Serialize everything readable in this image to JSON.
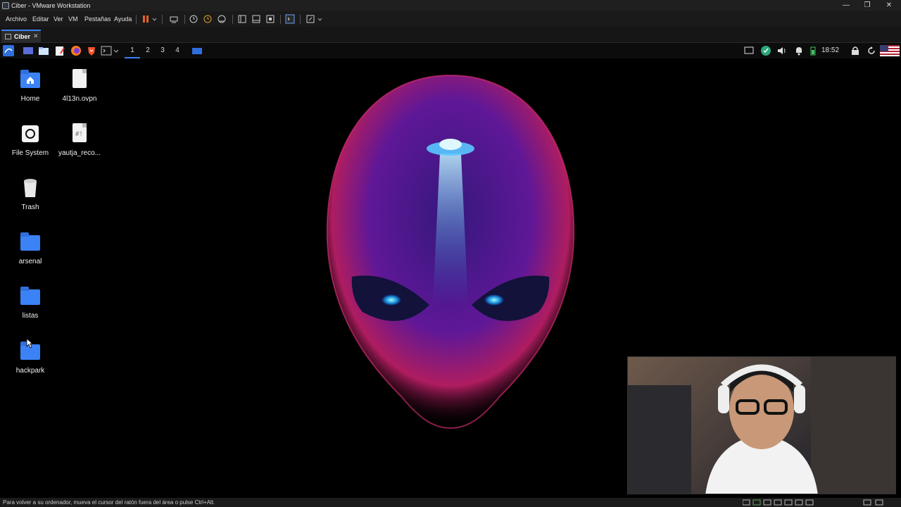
{
  "window": {
    "title": "Ciber - VMware Workstation",
    "controls": [
      "—",
      "❐",
      "✕"
    ]
  },
  "menubar": {
    "items": [
      "Archivo",
      "Editar",
      "Ver",
      "VM",
      "Pestañas",
      "Ayuda"
    ]
  },
  "tabs": [
    {
      "label": "Ciber",
      "close": "✕"
    }
  ],
  "guest_panel": {
    "workspaces": [
      "1",
      "2",
      "3",
      "4"
    ],
    "active_workspace": "1",
    "clock": "18:52"
  },
  "desktop": {
    "icons": [
      {
        "label": "Home",
        "icon": "home-folder-icon"
      },
      {
        "label": "4l13n.ovpn",
        "icon": "document-icon"
      },
      {
        "label": "File System",
        "icon": "drive-icon"
      },
      {
        "label": "yautja_reco...",
        "icon": "script-document-icon"
      },
      {
        "label": "Trash",
        "icon": "trash-icon"
      },
      {
        "label": "arsenal",
        "icon": "folder-icon"
      },
      {
        "label": "listas",
        "icon": "folder-icon"
      },
      {
        "label": "hackpark",
        "icon": "folder-icon"
      }
    ],
    "wallpaper": "alien-head-wallpaper"
  },
  "statusbar": {
    "text": "Para volver a su ordenador, mueva el cursor del ratón fuera del área o pulse Ctrl+Alt."
  },
  "colors": {
    "accent": "#3b82f6",
    "folder": "#3b82f6",
    "pause": "#e2622a"
  }
}
